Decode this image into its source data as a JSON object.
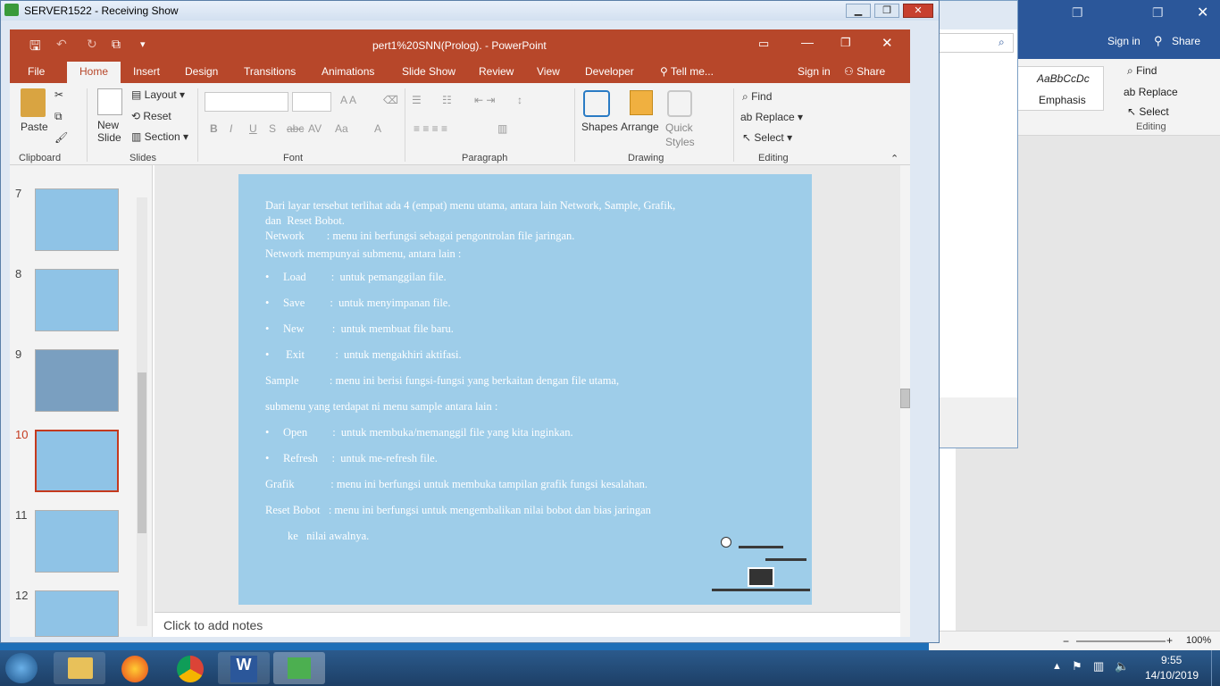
{
  "remote_window": {
    "title": "SERVER1522 - Receiving Show"
  },
  "word": {
    "sign_in": "Sign in",
    "share": "Share",
    "style_preview": "AaBbCcDc",
    "style_name": "Emphasis",
    "find": "Find",
    "replace": "Replace",
    "select": "Select",
    "editing": "Editing",
    "zoom": "100%"
  },
  "ppt": {
    "title": "pert1%20SNN(Prolog). - PowerPoint",
    "tabs": [
      "File",
      "Home",
      "Insert",
      "Design",
      "Transitions",
      "Animations",
      "Slide Show",
      "Review",
      "View",
      "Developer",
      "Tell me..."
    ],
    "sign_in": "Sign in",
    "share": "Share",
    "ribbon": {
      "paste": "Paste",
      "new_slide": "New Slide",
      "layout": "Layout",
      "reset": "Reset",
      "section": "Section",
      "shapes": "Shapes",
      "arrange": "Arrange",
      "quick_styles": "Quick Styles",
      "find": "Find",
      "replace": "Replace",
      "select": "Select",
      "groups": [
        "Clipboard",
        "Slides",
        "Font",
        "Paragraph",
        "Drawing",
        "Editing"
      ]
    },
    "thumbnails": [
      "7",
      "8",
      "9",
      "10",
      "11",
      "12"
    ],
    "notes_placeholder": "Click to add notes"
  },
  "slide": {
    "lines": [
      "Dari layar tersebut terlihat ada 4 (empat) menu utama, antara lain Network, Sample, Grafik,",
      "dan  Reset Bobot.",
      "Network        : menu ini berfungsi sebagai pengontrolan file jaringan.",
      "Network mempunyai submenu, antara lain :",
      "•     Load         :  untuk pemanggilan file.",
      "•     Save         :  untuk menyimpanan file.",
      "•     New          :  untuk membuat file baru.",
      "•      Exit           :  untuk mengakhiri aktifasi.",
      "Sample           : menu ini berisi fungsi-fungsi yang berkaitan dengan file utama,",
      "submenu yang terdapat ni menu sample antara lain :",
      "•     Open         :  untuk membuka/memanggil file yang kita inginkan.",
      "•     Refresh     :  untuk me-refresh file.",
      "Grafik             : menu ini berfungsi untuk membuka tampilan grafik fungsi kesalahan.",
      "Reset Bobot   : menu ini berfungsi untuk mengembalikan nilai bobot dan bias jaringan",
      "        ke   nilai awalnya."
    ]
  },
  "taskbar": {
    "time": "9:55",
    "date": "14/10/2019"
  }
}
